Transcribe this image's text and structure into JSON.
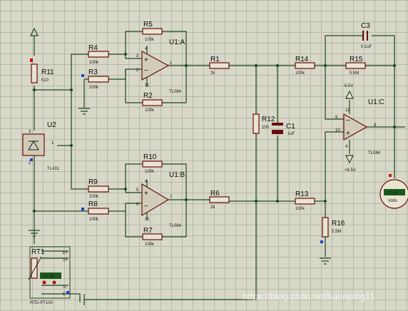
{
  "components": {
    "R1": {
      "ref": "R1",
      "value": "2k"
    },
    "R3": {
      "ref": "R3",
      "value": "100k"
    },
    "R4": {
      "ref": "R4",
      "value": "100k"
    },
    "R5": {
      "ref": "R5",
      "value": "100k"
    },
    "R2": {
      "ref": "R2",
      "value": "100k"
    },
    "R6": {
      "ref": "R6",
      "value": "2k"
    },
    "R7": {
      "ref": "R7",
      "value": "100k"
    },
    "R8": {
      "ref": "R8",
      "value": "100k"
    },
    "R9": {
      "ref": "R9",
      "value": "100k"
    },
    "R10": {
      "ref": "R10",
      "value": "100k"
    },
    "R11": {
      "ref": "R11",
      "value": "510"
    },
    "R12": {
      "ref": "R12",
      "value": "100"
    },
    "R13": {
      "ref": "R13",
      "value": "100k"
    },
    "R14": {
      "ref": "R14",
      "value": "100k"
    },
    "R15": {
      "ref": "R15",
      "value": "5.5M"
    },
    "R16": {
      "ref": "R16",
      "value": "5.5M"
    },
    "C1": {
      "ref": "C1",
      "value": "1uF"
    },
    "C3": {
      "ref": "C3",
      "value": "0.1uF"
    },
    "U1A": {
      "ref": "U1:A",
      "part": "TL084"
    },
    "U1B": {
      "ref": "U1:B",
      "part": "TL084"
    },
    "U1C": {
      "ref": "U1:C",
      "part": "TL084"
    },
    "U2": {
      "ref": "U2",
      "part": "TL431"
    },
    "RT1": {
      "ref": "RT1",
      "part": "RTD-PT100",
      "display": "51.00"
    },
    "voltmeter": {
      "display": "+2.43",
      "unit": "Volts"
    }
  },
  "supplies": {
    "neg": "-6.5V",
    "pos": "+6.5V"
  },
  "pins": {
    "a_in_plus": "3",
    "a_in_minus": "2",
    "a_out": "1",
    "a_top": "4",
    "a_bot": "11",
    "b_in_plus": "5",
    "b_in_minus": "6",
    "b_out": "7",
    "b_top": "4",
    "b_bot": "11",
    "c_in_minus": "9",
    "c_in_plus": "10",
    "c_out": "8",
    "c_top": "11",
    "c_bot": "4",
    "u2_1": "1",
    "u2_2": "2",
    "u2_3": "3"
  },
  "rtd_terms": [
    "E+",
    "S+",
    "S-",
    "E-"
  ],
  "watermark": "https://blog.csdn.net/lujunping11"
}
